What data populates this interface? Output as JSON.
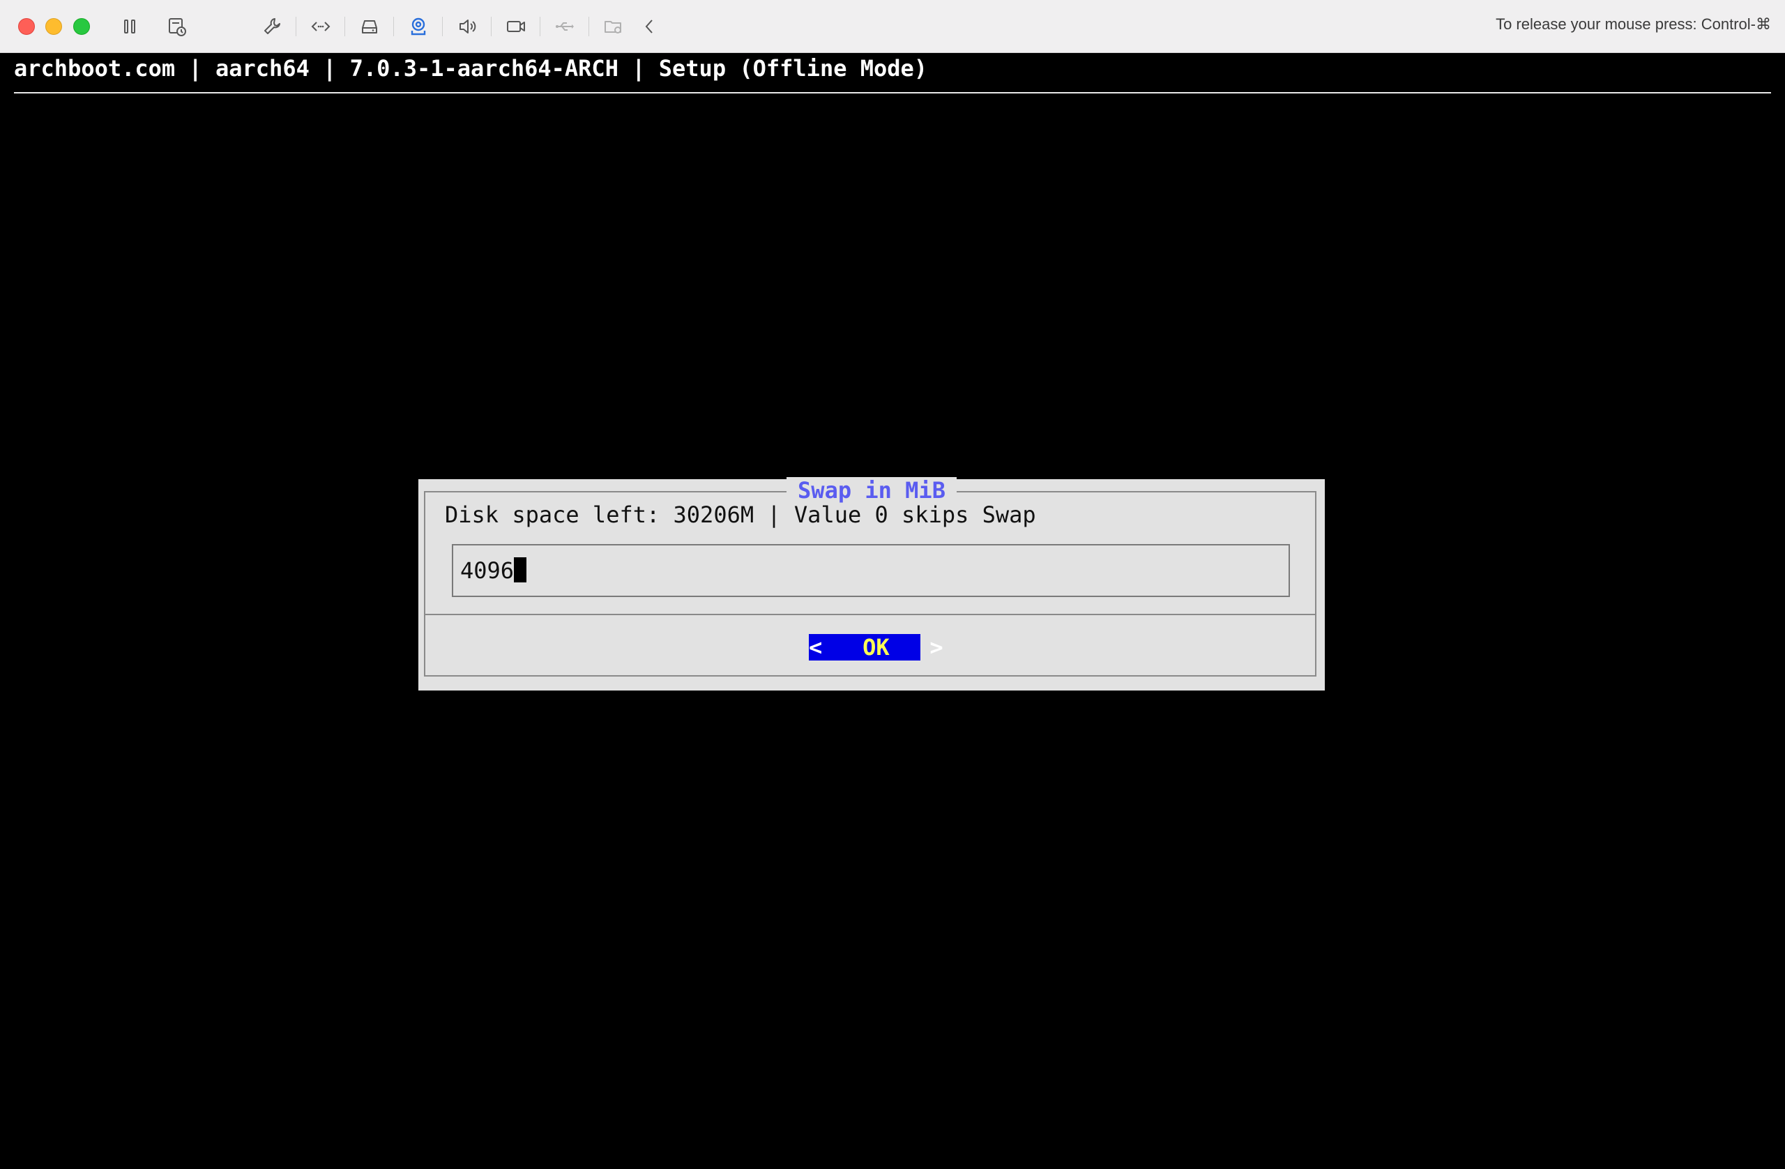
{
  "toolbar": {
    "icons": [
      "pause-icon",
      "snapshot-icon",
      "settings-wrench-icon",
      "network-arrows-icon",
      "disk-drive-icon",
      "camera-device-icon",
      "speaker-icon",
      "video-camera-icon",
      "usb-icon",
      "shared-folder-icon",
      "chevron-left-icon"
    ],
    "release_hint": "To release your mouse press: Control-⌘"
  },
  "terminal": {
    "header": "archboot.com | aarch64 | 7.0.3-1-aarch64-ARCH | Setup (Offline Mode)"
  },
  "dialog": {
    "title": "Swap in MiB",
    "prompt": "Disk space left: 30206M | Value 0 skips Swap",
    "input_value": "4096",
    "ok_left": "<",
    "ok_label": "OK",
    "ok_right": ">"
  },
  "colors": {
    "dialog_bg": "#e2e2e2",
    "title": "#5a5cf0",
    "button_bg": "#0000e6",
    "button_label": "#ffff55",
    "terminal_bg": "#000000"
  }
}
